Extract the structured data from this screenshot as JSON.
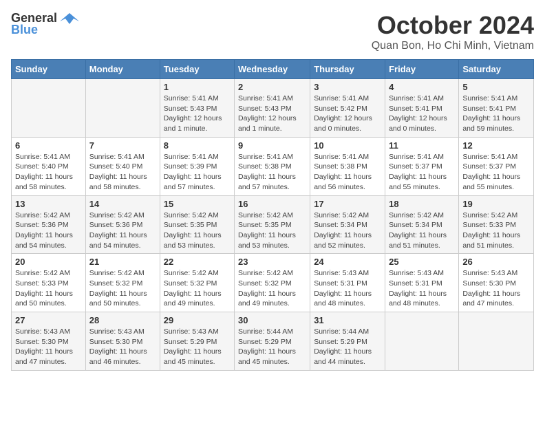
{
  "header": {
    "logo_general": "General",
    "logo_blue": "Blue",
    "title": "October 2024",
    "subtitle": "Quan Bon, Ho Chi Minh, Vietnam"
  },
  "weekdays": [
    "Sunday",
    "Monday",
    "Tuesday",
    "Wednesday",
    "Thursday",
    "Friday",
    "Saturday"
  ],
  "weeks": [
    [
      {
        "day": "",
        "info": ""
      },
      {
        "day": "",
        "info": ""
      },
      {
        "day": "1",
        "info": "Sunrise: 5:41 AM\nSunset: 5:43 PM\nDaylight: 12 hours and 1 minute."
      },
      {
        "day": "2",
        "info": "Sunrise: 5:41 AM\nSunset: 5:43 PM\nDaylight: 12 hours and 1 minute."
      },
      {
        "day": "3",
        "info": "Sunrise: 5:41 AM\nSunset: 5:42 PM\nDaylight: 12 hours and 0 minutes."
      },
      {
        "day": "4",
        "info": "Sunrise: 5:41 AM\nSunset: 5:41 PM\nDaylight: 12 hours and 0 minutes."
      },
      {
        "day": "5",
        "info": "Sunrise: 5:41 AM\nSunset: 5:41 PM\nDaylight: 11 hours and 59 minutes."
      }
    ],
    [
      {
        "day": "6",
        "info": "Sunrise: 5:41 AM\nSunset: 5:40 PM\nDaylight: 11 hours and 58 minutes."
      },
      {
        "day": "7",
        "info": "Sunrise: 5:41 AM\nSunset: 5:40 PM\nDaylight: 11 hours and 58 minutes."
      },
      {
        "day": "8",
        "info": "Sunrise: 5:41 AM\nSunset: 5:39 PM\nDaylight: 11 hours and 57 minutes."
      },
      {
        "day": "9",
        "info": "Sunrise: 5:41 AM\nSunset: 5:38 PM\nDaylight: 11 hours and 57 minutes."
      },
      {
        "day": "10",
        "info": "Sunrise: 5:41 AM\nSunset: 5:38 PM\nDaylight: 11 hours and 56 minutes."
      },
      {
        "day": "11",
        "info": "Sunrise: 5:41 AM\nSunset: 5:37 PM\nDaylight: 11 hours and 55 minutes."
      },
      {
        "day": "12",
        "info": "Sunrise: 5:41 AM\nSunset: 5:37 PM\nDaylight: 11 hours and 55 minutes."
      }
    ],
    [
      {
        "day": "13",
        "info": "Sunrise: 5:42 AM\nSunset: 5:36 PM\nDaylight: 11 hours and 54 minutes."
      },
      {
        "day": "14",
        "info": "Sunrise: 5:42 AM\nSunset: 5:36 PM\nDaylight: 11 hours and 54 minutes."
      },
      {
        "day": "15",
        "info": "Sunrise: 5:42 AM\nSunset: 5:35 PM\nDaylight: 11 hours and 53 minutes."
      },
      {
        "day": "16",
        "info": "Sunrise: 5:42 AM\nSunset: 5:35 PM\nDaylight: 11 hours and 53 minutes."
      },
      {
        "day": "17",
        "info": "Sunrise: 5:42 AM\nSunset: 5:34 PM\nDaylight: 11 hours and 52 minutes."
      },
      {
        "day": "18",
        "info": "Sunrise: 5:42 AM\nSunset: 5:34 PM\nDaylight: 11 hours and 51 minutes."
      },
      {
        "day": "19",
        "info": "Sunrise: 5:42 AM\nSunset: 5:33 PM\nDaylight: 11 hours and 51 minutes."
      }
    ],
    [
      {
        "day": "20",
        "info": "Sunrise: 5:42 AM\nSunset: 5:33 PM\nDaylight: 11 hours and 50 minutes."
      },
      {
        "day": "21",
        "info": "Sunrise: 5:42 AM\nSunset: 5:32 PM\nDaylight: 11 hours and 50 minutes."
      },
      {
        "day": "22",
        "info": "Sunrise: 5:42 AM\nSunset: 5:32 PM\nDaylight: 11 hours and 49 minutes."
      },
      {
        "day": "23",
        "info": "Sunrise: 5:42 AM\nSunset: 5:32 PM\nDaylight: 11 hours and 49 minutes."
      },
      {
        "day": "24",
        "info": "Sunrise: 5:43 AM\nSunset: 5:31 PM\nDaylight: 11 hours and 48 minutes."
      },
      {
        "day": "25",
        "info": "Sunrise: 5:43 AM\nSunset: 5:31 PM\nDaylight: 11 hours and 48 minutes."
      },
      {
        "day": "26",
        "info": "Sunrise: 5:43 AM\nSunset: 5:30 PM\nDaylight: 11 hours and 47 minutes."
      }
    ],
    [
      {
        "day": "27",
        "info": "Sunrise: 5:43 AM\nSunset: 5:30 PM\nDaylight: 11 hours and 47 minutes."
      },
      {
        "day": "28",
        "info": "Sunrise: 5:43 AM\nSunset: 5:30 PM\nDaylight: 11 hours and 46 minutes."
      },
      {
        "day": "29",
        "info": "Sunrise: 5:43 AM\nSunset: 5:29 PM\nDaylight: 11 hours and 45 minutes."
      },
      {
        "day": "30",
        "info": "Sunrise: 5:44 AM\nSunset: 5:29 PM\nDaylight: 11 hours and 45 minutes."
      },
      {
        "day": "31",
        "info": "Sunrise: 5:44 AM\nSunset: 5:29 PM\nDaylight: 11 hours and 44 minutes."
      },
      {
        "day": "",
        "info": ""
      },
      {
        "day": "",
        "info": ""
      }
    ]
  ]
}
